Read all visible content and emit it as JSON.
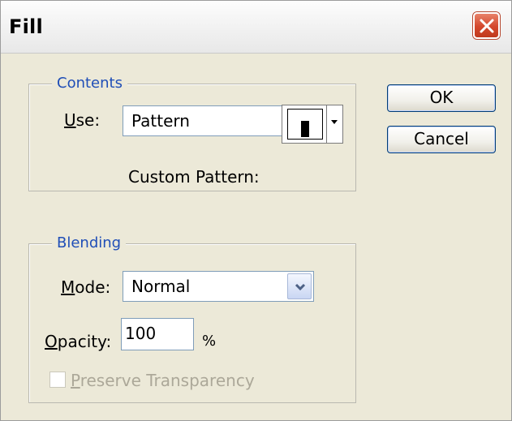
{
  "window": {
    "title": "Fill"
  },
  "contents": {
    "legend": "Contents",
    "use_label_mnemonic": "U",
    "use_label_rest": "se:",
    "use_value": "Pattern",
    "custom_pattern_label": "Custom Pattern:"
  },
  "blending": {
    "legend": "Blending",
    "mode_label_mnemonic": "M",
    "mode_label_rest": "ode:",
    "mode_value": "Normal",
    "opacity_label_mnemonic": "O",
    "opacity_label_rest": "pacity:",
    "opacity_value": "100",
    "opacity_unit": "%",
    "preserve_label_mnemonic": "P",
    "preserve_label_rest": "reserve Transparency",
    "preserve_checked": false,
    "preserve_enabled": false
  },
  "buttons": {
    "ok_label": "OK",
    "cancel_label": "Cancel"
  },
  "colors": {
    "legend": "#1f4eb7",
    "dialog_bg": "#ece9d8",
    "close_button": "#d4472c"
  }
}
